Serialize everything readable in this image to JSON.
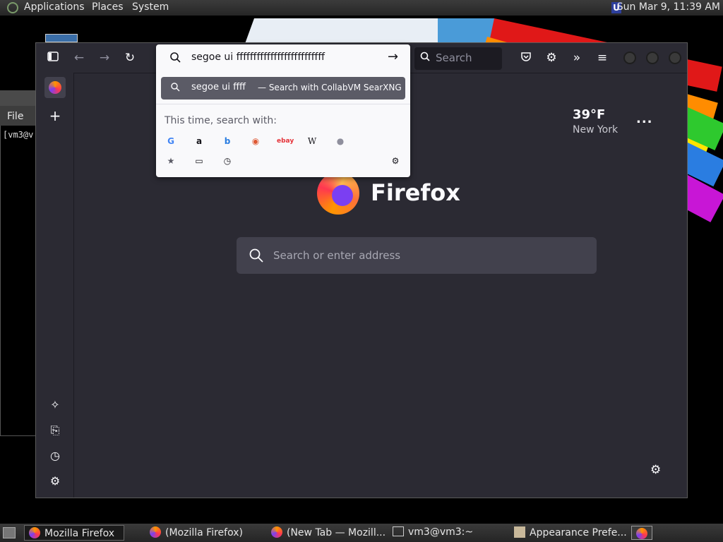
{
  "top_panel": {
    "menus": [
      "Applications",
      "Places",
      "System"
    ],
    "clock": "Sun Mar  9, 11:39 AM"
  },
  "terminal": {
    "menu_file": "File",
    "prompt": "[vm3@v"
  },
  "firefox": {
    "search_placeholder": "Search",
    "urlbar": {
      "value": "segoe ui ffffffffffffffffffffffffff",
      "suggestion_query": "segoe ui ffff",
      "suggestion_action": "— Search with CollabVM SearXNG",
      "search_with_label": "This time, search with:"
    },
    "weather": {
      "temperature": "39°F",
      "city": "New York",
      "more": "..."
    },
    "wordmark": "Firefox",
    "content_search_placeholder": "Search or enter address"
  },
  "taskbar": {
    "tasks": [
      {
        "label": "Mozilla Firefox"
      },
      {
        "label": "(Mozilla Firefox)"
      },
      {
        "label": "(New Tab — Mozill..."
      },
      {
        "label": "vm3@vm3:~"
      },
      {
        "label": "Appearance Prefe..."
      }
    ]
  },
  "colors": {
    "firefox_bg": "#2b2a33",
    "urlbar_bg": "#f9f9fb",
    "highlight_row": "#5b5b66"
  }
}
